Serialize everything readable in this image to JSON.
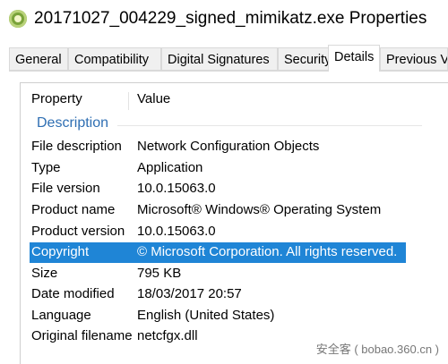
{
  "window": {
    "title": "20171027_004229_signed_mimikatz.exe Properties"
  },
  "tabs": [
    {
      "label": "General"
    },
    {
      "label": "Compatibility"
    },
    {
      "label": "Digital Signatures"
    },
    {
      "label": "Security"
    },
    {
      "label": "Details"
    },
    {
      "label": "Previous Ve"
    }
  ],
  "details": {
    "header": {
      "property": "Property",
      "value": "Value"
    },
    "group": "Description",
    "rows": [
      {
        "property": "File description",
        "value": "Network Configuration Objects"
      },
      {
        "property": "Type",
        "value": "Application"
      },
      {
        "property": "File version",
        "value": "10.0.15063.0"
      },
      {
        "property": "Product name",
        "value": "Microsoft® Windows® Operating System"
      },
      {
        "property": "Product version",
        "value": "10.0.15063.0"
      },
      {
        "property": "Copyright",
        "value": "© Microsoft Corporation. All rights reserved."
      },
      {
        "property": "Size",
        "value": "795 KB"
      },
      {
        "property": "Date modified",
        "value": "18/03/2017 20:57"
      },
      {
        "property": "Language",
        "value": "English (United States)"
      },
      {
        "property": "Original filename",
        "value": "netcfgx.dll"
      }
    ],
    "selected_index": 5
  },
  "watermark": {
    "text": "安全客 ( bobao.360.cn )"
  },
  "colors": {
    "selection": "#1f85d6",
    "group_label": "#2f6fb3"
  },
  "icons": {
    "app": "kiwi-mimikatz-icon"
  }
}
